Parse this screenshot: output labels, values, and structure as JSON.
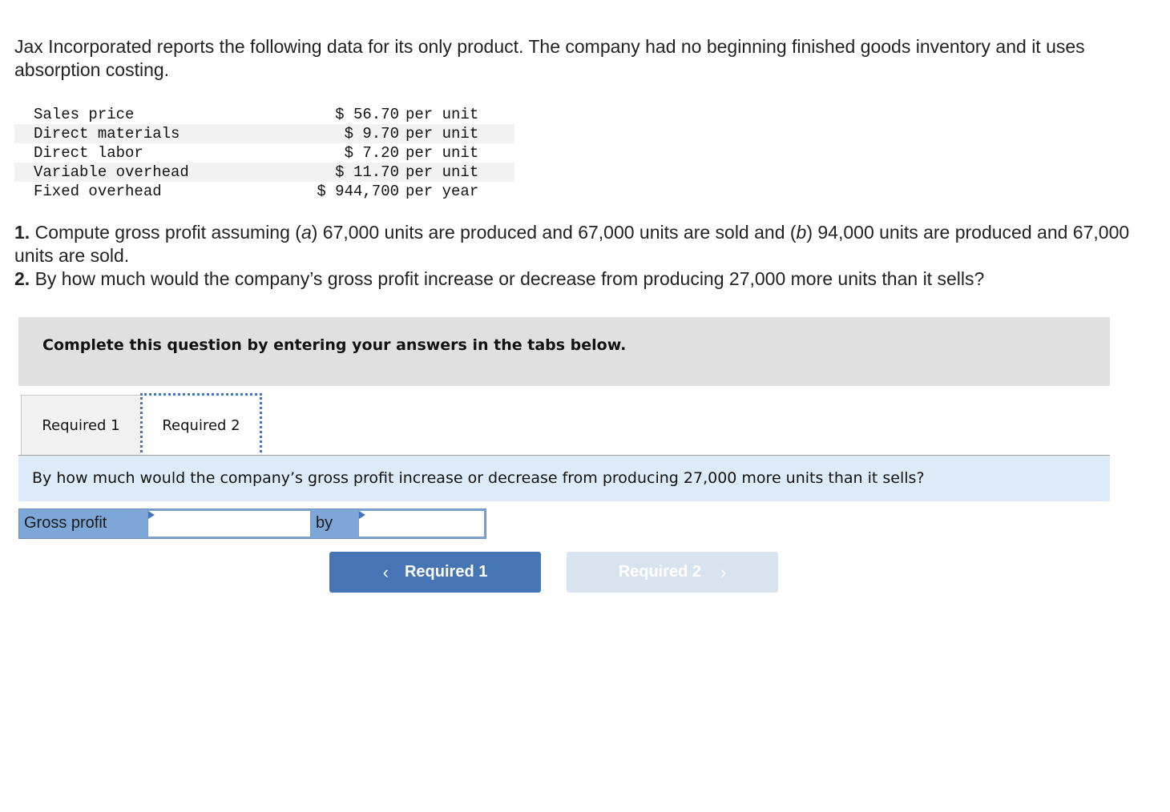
{
  "intro": "Jax Incorporated reports the following data for its only product. The company had no beginning finished goods inventory and it uses absorption costing.",
  "data_table": [
    {
      "label": "Sales price",
      "amount": "$ 56.70",
      "unit": "per unit"
    },
    {
      "label": "Direct materials",
      "amount": "$ 9.70",
      "unit": "per unit"
    },
    {
      "label": "Direct labor",
      "amount": "$ 7.20",
      "unit": "per unit"
    },
    {
      "label": "Variable overhead",
      "amount": "$ 11.70",
      "unit": "per unit"
    },
    {
      "label": "Fixed overhead",
      "amount": "$ 944,700",
      "unit": "per year"
    }
  ],
  "questions": {
    "q1_num": "1.",
    "q1_text_1": " Compute gross profit assuming (",
    "q1_a": "a",
    "q1_text_2": ") 67,000 units are produced and 67,000 units are sold and (",
    "q1_b": "b",
    "q1_text_3": ") 94,000 units are produced and 67,000 units are sold.",
    "q2_num": "2.",
    "q2_text": " By how much would the company’s gross profit increase or decrease from producing 27,000 more units than it sells?"
  },
  "banner": "Complete this question by entering your answers in the tabs below.",
  "tabs": [
    {
      "label": "Required 1",
      "active": false
    },
    {
      "label": "Required 2",
      "active": true
    }
  ],
  "question_bar": "By how much would the company’s gross profit increase or decrease from producing 27,000 more units than it sells?",
  "answer_row": {
    "label": "Gross profit",
    "input1_value": "",
    "by_label": "by",
    "input2_value": ""
  },
  "nav": {
    "prev_label": "Required 1",
    "prev_icon": "‹",
    "next_label": "Required 2",
    "next_icon": "›"
  },
  "colors": {
    "primary_button": "#4675b6",
    "disabled_button": "#d9e3ef",
    "answer_row_bg": "#7ea7d9",
    "question_bar_bg": "#dcebf7",
    "banner_bg": "#e0e0e0"
  }
}
